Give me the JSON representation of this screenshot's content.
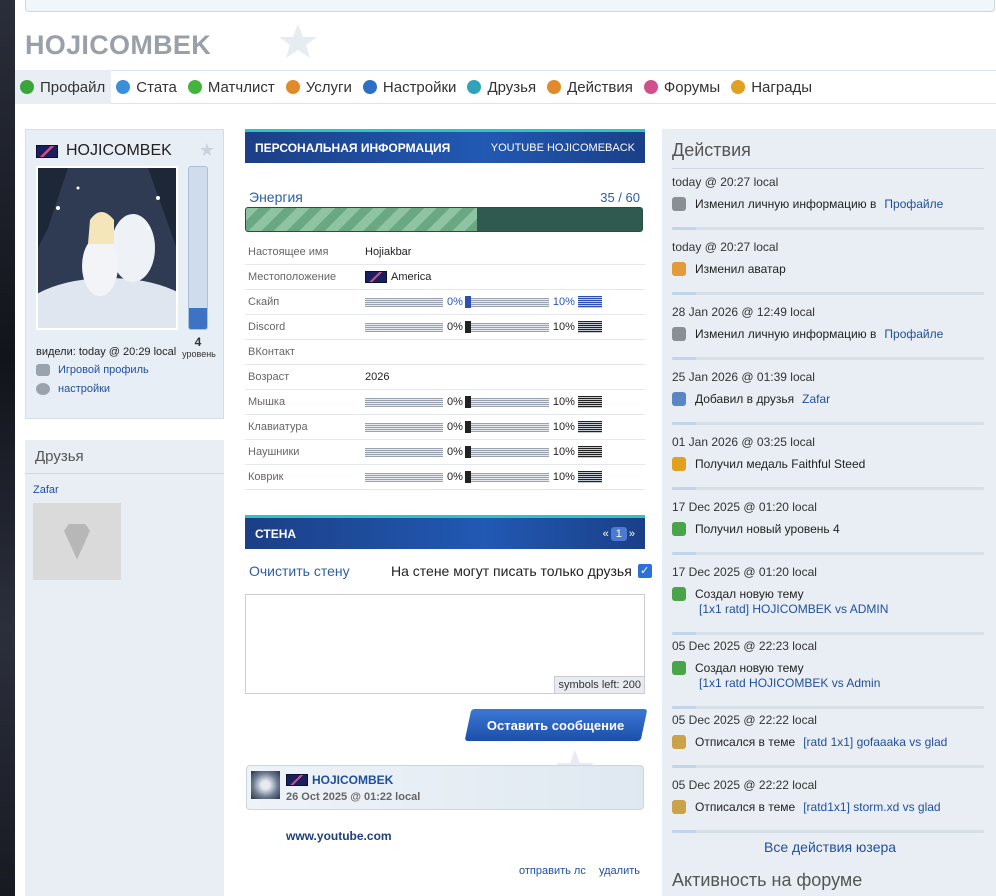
{
  "page_title": "HOJICOMBEK",
  "tabs": [
    {
      "label": "Профайл",
      "active": true,
      "icon": "profile-icon",
      "color": "#3aa63a"
    },
    {
      "label": "Стата",
      "active": false,
      "icon": "stats-icon",
      "color": "#3a8fd8"
    },
    {
      "label": "Матчлист",
      "active": false,
      "icon": "matchlist-icon",
      "color": "#47b33f"
    },
    {
      "label": "Услуги",
      "active": false,
      "icon": "services-icon",
      "color": "#e08a2a"
    },
    {
      "label": "Настройки",
      "active": false,
      "icon": "gear-icon",
      "color": "#2d6fc7"
    },
    {
      "label": "Друзья",
      "active": false,
      "icon": "friends-icon",
      "color": "#2fa3b8"
    },
    {
      "label": "Действия",
      "active": false,
      "icon": "actions-icon",
      "color": "#e2892a"
    },
    {
      "label": "Форумы",
      "active": false,
      "icon": "forums-icon",
      "color": "#d14f8a"
    },
    {
      "label": "Награды",
      "active": false,
      "icon": "awards-icon",
      "color": "#e0a020"
    }
  ],
  "profile": {
    "username": "HOJICOMBEK",
    "level": "4",
    "level_label": "уровень",
    "level_progress": 0.13,
    "seen": "видели: today @ 20:29 local",
    "game_profile": "Игровой профиль",
    "settings": "настройки"
  },
  "friends": {
    "title": "Друзья",
    "items": [
      {
        "name": "Zafar"
      }
    ]
  },
  "personal": {
    "banner_title": "ПЕРСОНАЛЬНАЯ ИНФОРМАЦИЯ",
    "banner_right": "YOUTUBE HOJICOMEBACK",
    "energy_label": "Энергия",
    "energy_value": "35 / 60",
    "energy_fraction": 0.583,
    "rows": [
      {
        "key": "Настоящее имя",
        "value": "Hojiakbar",
        "kind": "text"
      },
      {
        "key": "Местоположение",
        "value": "America",
        "kind": "flag"
      },
      {
        "key": "Скайп",
        "kind": "bar",
        "blue": true,
        "p1": "0%",
        "p2": "10%"
      },
      {
        "key": "Discord",
        "kind": "bar",
        "blue": false,
        "p1": "0%",
        "p2": "10%"
      },
      {
        "key": "ВКонтакт",
        "value": "",
        "kind": "text"
      },
      {
        "key": "Возраст",
        "value": "2026",
        "kind": "text"
      },
      {
        "key": "Мышка",
        "kind": "bar",
        "blue": false,
        "p1": "0%",
        "p2": "10%"
      },
      {
        "key": "Клавиатура",
        "kind": "bar",
        "blue": false,
        "p1": "0%",
        "p2": "10%"
      },
      {
        "key": "Наушники",
        "kind": "bar",
        "blue": false,
        "p1": "0%",
        "p2": "10%"
      },
      {
        "key": "Коврик",
        "kind": "bar",
        "blue": false,
        "p1": "0%",
        "p2": "10%"
      }
    ]
  },
  "wall": {
    "banner_title": "СТЕНА",
    "pager_prev": "«",
    "page": "1",
    "pager_next": "»",
    "clear": "Очистить стену",
    "friends_only": "На стене могут писать только друзья",
    "friends_only_checked": true,
    "symbols_left": "symbols left: 200",
    "submit": "Оставить сообщение",
    "post": {
      "author": "HOJICOMBEK",
      "date": "26 Oct 2025 @ 01:22 local",
      "text": "www.youtube.com",
      "send_pm": "отправить лс",
      "delete": "удалить"
    }
  },
  "actions": {
    "title": "Действия",
    "items": [
      {
        "date": "today @ 20:27 local",
        "icon": "wrench-icon",
        "text": "Изменил личную информацию в",
        "link": "Профайле",
        "sub": ""
      },
      {
        "date": "today @ 20:27 local",
        "icon": "user-icon",
        "text": "Изменил аватар",
        "link": "",
        "sub": ""
      },
      {
        "date": "28 Jan 2026 @ 12:49 local",
        "icon": "wrench-icon",
        "text": "Изменил личную информацию в",
        "link": "Профайле",
        "sub": ""
      },
      {
        "date": "25 Jan 2026 @ 01:39 local",
        "icon": "add-user-icon",
        "text": "Добавил в друзья",
        "link": "Zafar",
        "sub": ""
      },
      {
        "date": "01 Jan 2026 @ 03:25 local",
        "icon": "medal-icon",
        "text": "Получил медаль  Faithful Steed",
        "link": "",
        "sub": ""
      },
      {
        "date": "17 Dec 2025 @ 01:20 local",
        "icon": "shield-icon",
        "text": "Получил новый уровень  4",
        "link": "",
        "sub": ""
      },
      {
        "date": "17 Dec 2025 @ 01:20 local",
        "icon": "new-topic-icon",
        "text": "Создал новую тему",
        "link": "",
        "sub": "[1x1 ratd] HOJICOMBEK vs ADMIN"
      },
      {
        "date": "05 Dec 2025 @ 22:23 local",
        "icon": "new-topic-icon",
        "text": "Создал новую тему",
        "link": "",
        "sub": "[1x1 ratd HOJICOMBEK vs Admin"
      },
      {
        "date": "05 Dec 2025 @ 22:22 local",
        "icon": "reply-icon",
        "text": "Отписался в теме",
        "link": "[ratd 1x1] gofaaaka vs glad",
        "sub": ""
      },
      {
        "date": "05 Dec 2025 @ 22:22 local",
        "icon": "reply-icon",
        "text": "Отписался в теме",
        "link": "[ratd1x1] storm.xd vs glad",
        "sub": ""
      }
    ],
    "all_link": "Все действия юзера",
    "forum_activity_title": "Активность на форуме"
  },
  "colors": {
    "accent": "#1f4f9a",
    "banner": "#2159b3",
    "banner_top": "#2cc3c9",
    "energy_fill": "#8fc4a2"
  }
}
